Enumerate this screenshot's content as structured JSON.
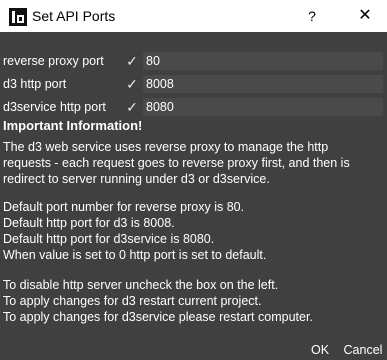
{
  "window": {
    "title": "Set API Ports",
    "help_label": "?",
    "close_label": "✕"
  },
  "ports": [
    {
      "label": "reverse proxy port",
      "checked": true,
      "check_glyph": "✓",
      "value": "80"
    },
    {
      "label": "d3 http port",
      "checked": true,
      "check_glyph": "✓",
      "value": "8008"
    },
    {
      "label": "d3service http port",
      "checked": true,
      "check_glyph": "✓",
      "value": "8080"
    }
  ],
  "info": {
    "heading": "Important Information!",
    "paragraph1": "The d3 web service uses reverse proxy to manage the http\nrequests - each request goes to reverse proxy first, and then is\nredirect to server running under d3 or d3service.",
    "paragraph2": "Default port number for reverse proxy is 80.\nDefault http port for d3 is 8008.\nDefault http port for d3service is 8080.\nWhen value is set to 0 http port is set to default.",
    "paragraph3": "To disable http server uncheck the box on the left.\nTo apply changes for d3 restart current project.\nTo apply changes for d3service please restart computer."
  },
  "buttons": {
    "ok": "OK",
    "cancel": "Cancel"
  },
  "colors": {
    "dialog_background": "#404040",
    "input_background": "#4a4a4a",
    "text": "#ffffff",
    "titlebar": "#ffffff"
  }
}
